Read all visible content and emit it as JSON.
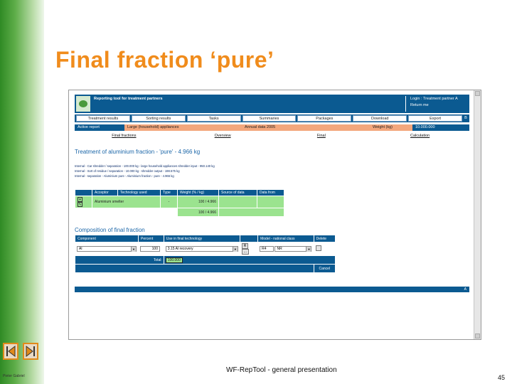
{
  "slide": {
    "title": "Final fraction ‘pure’",
    "footer": "WF-RepTool - general presentation",
    "author": "Pieter Gabriel",
    "page": "45"
  },
  "app": {
    "title": "Reporting tool for treatment partners",
    "login": [
      "Login : Treatment partner A",
      "Return me"
    ],
    "menu": [
      "Treatment results",
      "Sorting results",
      "Tasks",
      "Summaries",
      "Packages",
      "Download",
      "Export"
    ],
    "menu_end": "B",
    "subnav": [
      "Active report",
      "Large (household) appliances",
      "Annual data 2005",
      "Weight (kg)",
      "10.000.000"
    ],
    "links": [
      "Final fractions",
      "Overview",
      "Final",
      "Calculation"
    ],
    "section_title": "Treatment of aluminium fraction - 'pure' - 4.966 kg",
    "info_lines": [
      "Internal - Car shredder / separation - 100.000 kg - large household appliances shredder input - 950.140 kg",
      "Internal - Sort of residue / separation - 10.000 kg - shredder output - 198.575 kg",
      "Internal - separation - Aluminium pure - Aluminium fraction - pure - 4.966 kg"
    ],
    "acceptor_table": {
      "headers": [
        "Acceptor",
        "Technology used",
        "Type",
        "Weight (% / kg)",
        "Source of data",
        "Data from"
      ],
      "row": [
        "Aluminium smelter",
        "",
        "",
        "100 / 4.966",
        "",
        ""
      ],
      "total": "100 / 4.966"
    },
    "composition": {
      "title": "Composition of final fraction",
      "headers": [
        "Component",
        "Percent",
        "Use in final technology",
        "",
        "Model - national class",
        "Delete"
      ],
      "row": {
        "component": "Al",
        "percent": "100",
        "use": "3.15 Al recovery",
        "r_btn": "R",
        "dots": "...",
        "model": "R4",
        "cls": "NR"
      },
      "total_label": "Total:",
      "total_value": "100.000",
      "cancel": "Cancel"
    },
    "bottom_end": "A"
  },
  "colors": {
    "accent": "#f08c1c",
    "header_blue": "#0b5a91",
    "row_green": "#9be38f",
    "subnav_orange": "#f3a77d"
  }
}
